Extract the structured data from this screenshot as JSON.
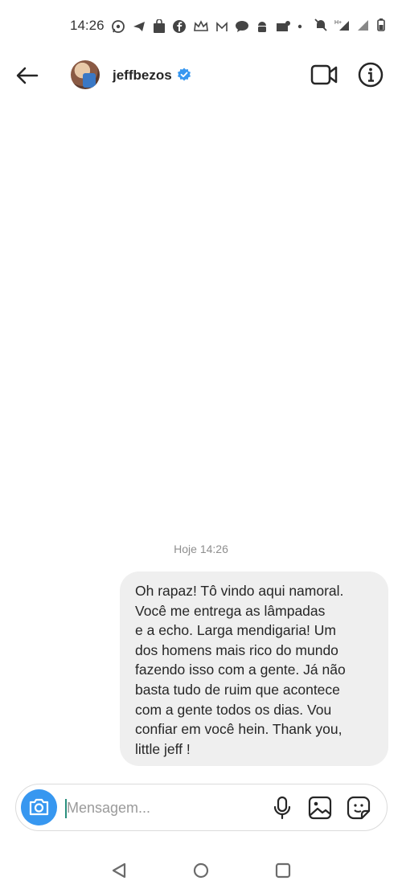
{
  "status_bar": {
    "time": "14:26",
    "icons": [
      "whatsapp-icon",
      "telegram-icon",
      "shopping-bag-icon",
      "facebook-icon",
      "crown-icon",
      "gmail-icon",
      "chat-icon",
      "android-icon",
      "mail-icon",
      "dot-icon",
      "mute-icon",
      "hd-signal-icon",
      "signal-icon",
      "battery-icon"
    ]
  },
  "header": {
    "username": "jeffbezos",
    "verified": true,
    "accent": "#3797f0"
  },
  "conversation": {
    "timestamp": "Hoje 14:26",
    "message_lines": [
      "Oh rapaz! Tô vindo aqui namoral.",
      "Você me entrega as lâmpadas",
      "e a echo. Larga mendigaria! Um",
      "dos homens mais rico do mundo",
      "fazendo isso com a gente. Já não",
      "basta tudo de ruim que acontece",
      "com a gente todos os dias. Vou",
      "confiar em você hein. Thank you,",
      "little jeff !"
    ]
  },
  "composer": {
    "placeholder": "Mensagem..."
  },
  "nav": {
    "icons": [
      "back-triangle-icon",
      "home-circle-icon",
      "recents-square-icon"
    ]
  }
}
